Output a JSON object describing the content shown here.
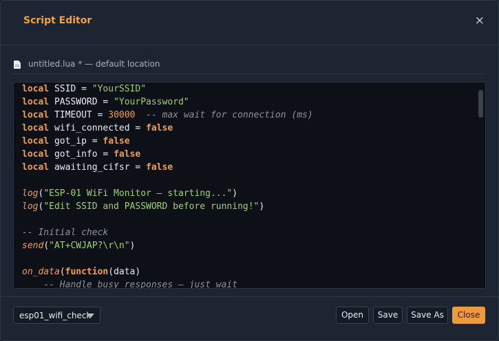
{
  "dialog": {
    "title": "Script Editor",
    "close_symbol": "×",
    "close_icon": "close-icon"
  },
  "file": {
    "icon": "file-icon",
    "label": "untitled.lua * — default location"
  },
  "editor": {
    "lines": [
      [
        [
          "kw",
          "local"
        ],
        [
          "",
          "SSID = "
        ],
        [
          "str",
          "\"YourSSID\""
        ]
      ],
      [
        [
          "kw",
          "local"
        ],
        [
          "",
          "PASSWORD = "
        ],
        [
          "str",
          "\"YourPassword\""
        ]
      ],
      [
        [
          "kw",
          "local"
        ],
        [
          "",
          "TIMEOUT = "
        ],
        [
          "num",
          "30000"
        ],
        [
          "",
          "  "
        ],
        [
          "cmt",
          "-- max wait for connection (ms)"
        ]
      ],
      [
        [
          "kw",
          "local"
        ],
        [
          "",
          "wifi_connected = "
        ],
        [
          "kw",
          "false"
        ]
      ],
      [
        [
          "kw",
          "local"
        ],
        [
          "",
          "got_ip = "
        ],
        [
          "kw",
          "false"
        ]
      ],
      [
        [
          "kw",
          "local"
        ],
        [
          "",
          "got_info = "
        ],
        [
          "kw",
          "false"
        ]
      ],
      [
        [
          "kw",
          "local"
        ],
        [
          "",
          "awaiting_cifsr = "
        ],
        [
          "kw",
          "false"
        ]
      ],
      [],
      [
        [
          "fn",
          "log"
        ],
        [
          "",
          "("
        ],
        [
          "str",
          "\"ESP-01 WiFi Monitor — starting...\""
        ],
        [
          "",
          ")"
        ]
      ],
      [
        [
          "fn",
          "log"
        ],
        [
          "",
          "("
        ],
        [
          "str",
          "\"Edit SSID and PASSWORD before running!\""
        ],
        [
          "",
          ")"
        ]
      ],
      [],
      [
        [
          "cmt",
          "-- Initial check"
        ]
      ],
      [
        [
          "fn",
          "send"
        ],
        [
          "",
          "("
        ],
        [
          "str",
          "\"AT+CWJAP?\\r\\n\""
        ],
        [
          "",
          ")"
        ]
      ],
      [],
      [
        [
          "fn",
          "on_data"
        ],
        [
          "",
          "("
        ],
        [
          "kw",
          "function"
        ],
        [
          "",
          "(data)"
        ]
      ],
      [
        [
          "",
          "    "
        ],
        [
          "cmt",
          "-- Handle busy responses — just wait"
        ]
      ]
    ]
  },
  "footer": {
    "script_select": {
      "selected": "esp01_wifi_check"
    },
    "buttons": {
      "open": "Open",
      "save": "Save",
      "save_as": "Save As",
      "close": "Close"
    }
  },
  "colors": {
    "accent": "#f3a23f",
    "keyword": "#f0a040",
    "string": "#9fd26a",
    "comment": "#8a939d",
    "background": "#1c2531",
    "editor_background": "#0d1117"
  }
}
